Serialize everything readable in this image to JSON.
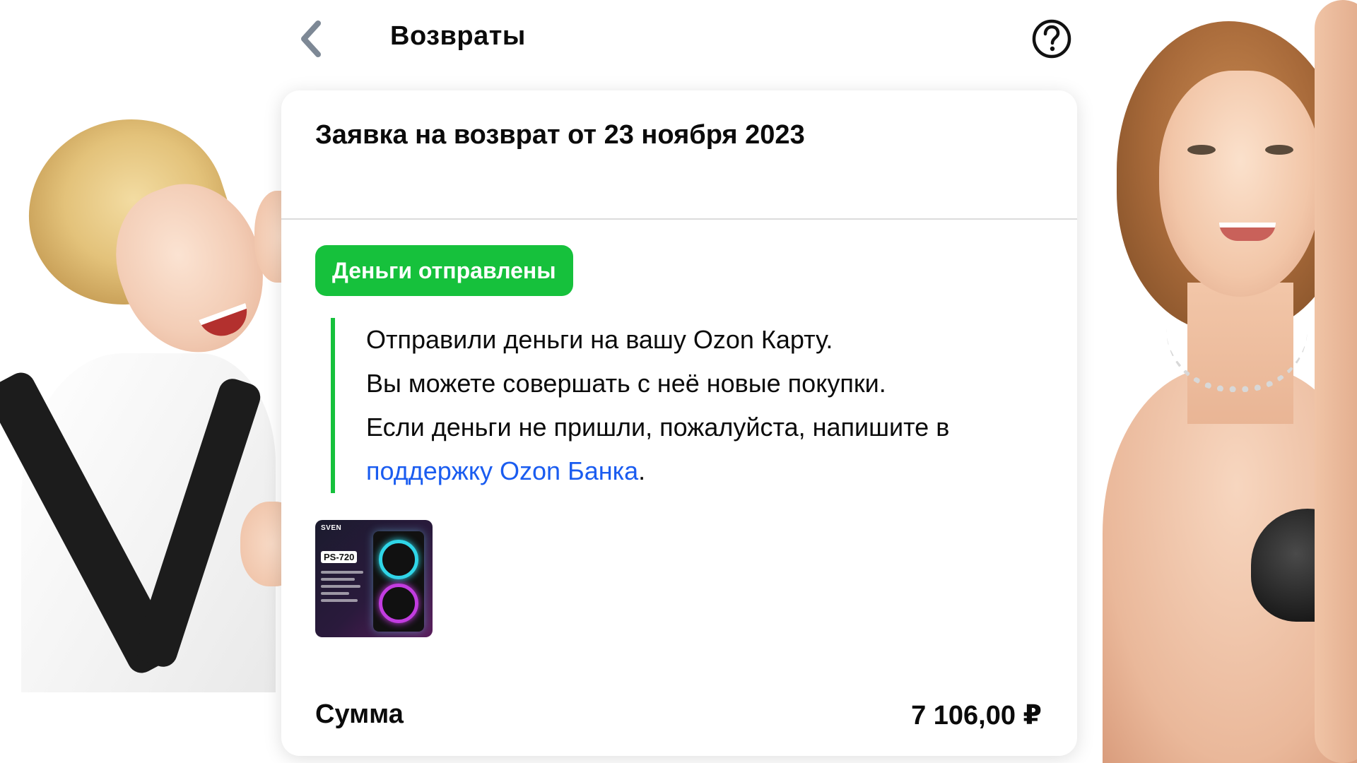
{
  "header": {
    "title": "Возвраты",
    "back_icon": "chevron-left-icon",
    "help_icon": "question-circle-icon"
  },
  "card": {
    "title": "Заявка на возврат от 23 ноября 2023",
    "status": {
      "label": "Деньги отправлены",
      "color": "#16c13c"
    },
    "message": {
      "line1": "Отправили деньги на вашу Ozon Карту.",
      "line2": "Вы можете совершать с неё новые покупки.",
      "line3": "Если деньги не пришли, пожалуйста, напишите в",
      "link_text": "поддержку Ozon Банка",
      "after_link": ".",
      "link_color": "#1a5cf0"
    },
    "product": {
      "brand": "SVEN",
      "model": "PS-720"
    },
    "sum": {
      "label": "Сумма",
      "value": "7 106,00 ₽"
    }
  }
}
